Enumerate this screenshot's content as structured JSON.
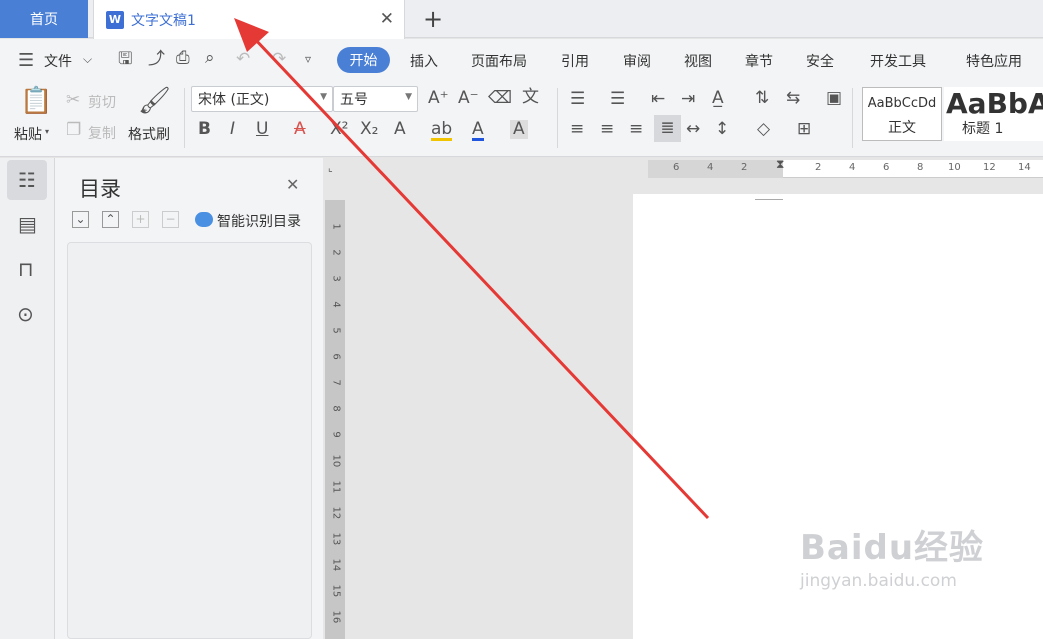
{
  "tabs": {
    "home": "首页",
    "document": "文字文稿1",
    "document_icon": "W"
  },
  "menu": {
    "file": "文件",
    "items": [
      "开始",
      "插入",
      "页面布局",
      "引用",
      "审阅",
      "视图",
      "章节",
      "安全",
      "开发工具",
      "特色应用"
    ],
    "active": "开始"
  },
  "ribbon": {
    "paste": "粘贴",
    "cut": "剪切",
    "copy": "复制",
    "format_painter": "格式刷",
    "font_name": "宋体 (正文)",
    "font_size": "五号",
    "style_normal_preview": "AaBbCcDd",
    "style_normal": "正文",
    "style_heading_preview": "AaBbA",
    "style_heading": "标题 1"
  },
  "toc": {
    "title": "目录",
    "smart_toc": "智能识别目录"
  },
  "ruler": {
    "horizontal": [
      "6",
      "4",
      "2",
      "2",
      "4",
      "6",
      "8",
      "10",
      "12",
      "14"
    ],
    "vertical": [
      "1",
      "2",
      "3",
      "4",
      "5",
      "6",
      "7",
      "8",
      "9",
      "10",
      "11",
      "12",
      "13",
      "14",
      "15",
      "16"
    ]
  },
  "watermark": {
    "brand": "Baidu经验",
    "url": "jingyan.baidu.com"
  },
  "colors": {
    "accent": "#4a7fd6",
    "annotation_arrow": "#e53935"
  }
}
